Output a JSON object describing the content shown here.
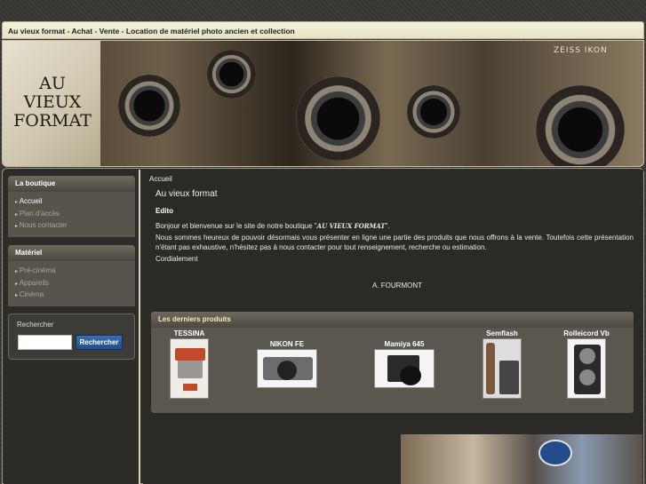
{
  "top_title": "Au vieux format - Achat - Vente - Location de matériel photo ancien et collection",
  "logo": {
    "line1": "AU",
    "line2": "VIEUX",
    "line3": "FORMAT"
  },
  "banner_brand": "ZEISS IKON",
  "sidebar": {
    "boutique": {
      "title": "La boutique",
      "items": [
        {
          "label": "Accueil",
          "active": true
        },
        {
          "label": "Plan d'accès",
          "active": false
        },
        {
          "label": "Nous contacter",
          "active": false
        }
      ]
    },
    "materiel": {
      "title": "Matériel",
      "items": [
        {
          "label": "Pré-cinéma"
        },
        {
          "label": "Appareils"
        },
        {
          "label": "Cinéma"
        }
      ]
    },
    "search": {
      "label": "Rechercher",
      "placeholder": "",
      "button": "Rechercher"
    }
  },
  "content": {
    "breadcrumb": "Accueil",
    "title": "Au vieux format",
    "edito": "Edito",
    "para1_before": "Bonjour et bienvenue sur le site de notre boutique \"",
    "para1_shop": "AU VIEUX FORMAT",
    "para1_after": "\".",
    "para2": "Nous sommes heureux de pouvoir désormais vous présenter en ligne une partie des produits que nous offrons à la vente. Toutefois cette présentation n'étant pas exhaustive, n'hésitez pas à nous contacter pour tout renseignement, recherche ou estimation.",
    "para3": "Cordialement",
    "signature": "A. FOURMONT"
  },
  "products": {
    "title": "Les derniers produits",
    "items": [
      {
        "name": "TESSINA"
      },
      {
        "name": "NIKON FE"
      },
      {
        "name": "Mamiya 645"
      },
      {
        "name": "Semflash"
      },
      {
        "name": "Rolleicord Vb"
      }
    ]
  },
  "colors": {
    "accent_button": "#214d8c",
    "product_header_text": "#f3eeb4",
    "background": "#3a3834"
  }
}
